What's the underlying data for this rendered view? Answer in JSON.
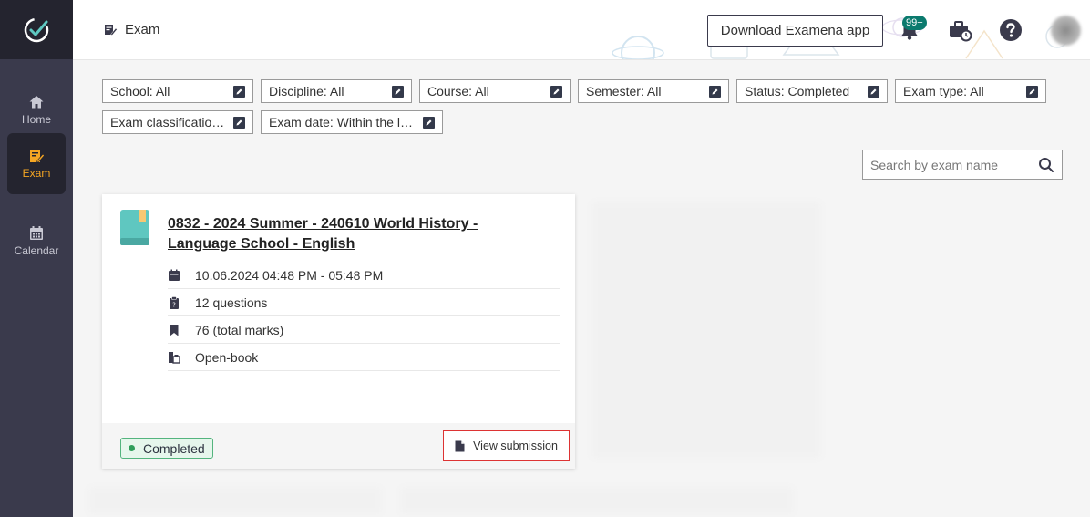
{
  "sidebar": {
    "items": [
      {
        "label": "Home",
        "icon": "home-icon",
        "active": false
      },
      {
        "label": "Exam",
        "icon": "exam-icon",
        "active": true
      },
      {
        "label": "Calendar",
        "icon": "calendar-icon",
        "active": false
      }
    ]
  },
  "header": {
    "breadcrumb": "Exam",
    "download_label": "Download Examena app",
    "notification_badge": "99+"
  },
  "filters": [
    {
      "label": "School: All"
    },
    {
      "label": "Discipline: All"
    },
    {
      "label": "Course: All"
    },
    {
      "label": "Semester: All"
    },
    {
      "label": "Status: Completed"
    },
    {
      "label": "Exam type: All"
    },
    {
      "label": "Exam classification: All"
    },
    {
      "label": "Exam date: Within the last month"
    }
  ],
  "search": {
    "placeholder": "Search by exam name",
    "value": ""
  },
  "exam_card": {
    "title": "0832 - 2024 Summer - 240610 World History - Language School - English",
    "datetime": "10.06.2024 04:48 PM - 05:48 PM",
    "questions": "12 questions",
    "marks": "76 (total marks)",
    "book_type": "Open-book",
    "status": "Completed",
    "action_label": "View submission"
  },
  "colors": {
    "sidebar_bg": "#3a3a4c",
    "active_accent": "#f5a623",
    "status_green": "#2f9e5a",
    "badge_teal": "#0b7a6e",
    "book_teal": "#5fc7c0"
  }
}
